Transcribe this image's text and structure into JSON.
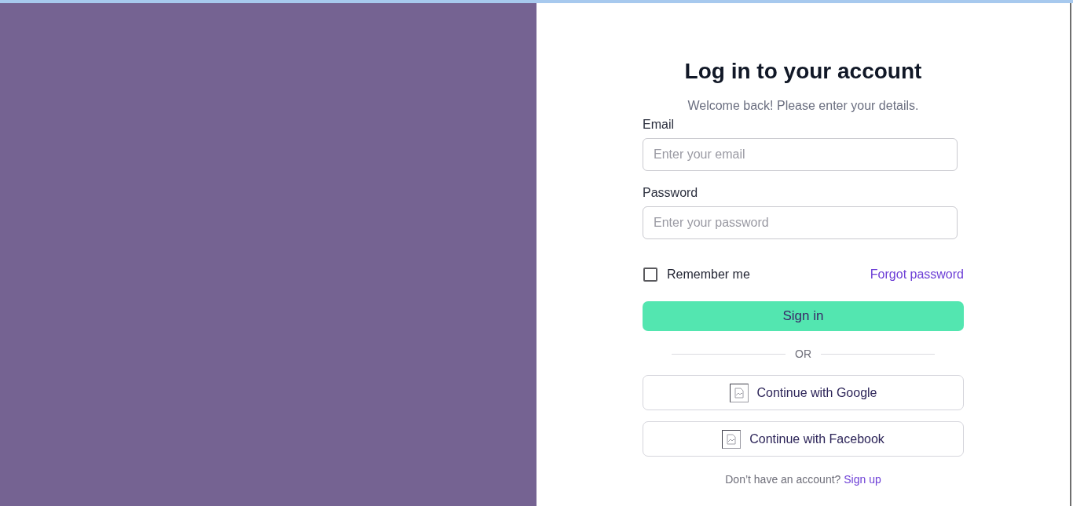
{
  "title": "Log in to your account",
  "subtitle": "Welcome back! Please enter your details.",
  "fields": [
    {
      "label": "Email",
      "placeholder": "Enter your email"
    },
    {
      "label": "Password",
      "placeholder": "Enter your password"
    }
  ],
  "remember": {
    "label": "Remember me",
    "checked": false
  },
  "forgot_link": "Forgot password",
  "submit": "Sign in",
  "divider": "OR",
  "social_buttons": [
    {
      "label": "Continue with Google"
    },
    {
      "label": "Continue with Facebook"
    }
  ],
  "footer": {
    "text": "Don’t have an account?",
    "link": "Sign up"
  }
}
